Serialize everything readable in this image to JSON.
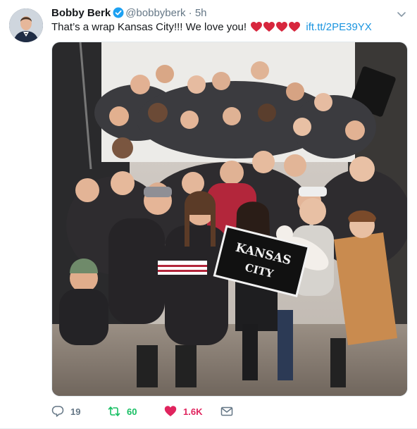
{
  "tweet": {
    "author": {
      "name": "Bobby Berk",
      "handle": "@bobbyberk",
      "separator": "·",
      "time": "5h",
      "verified": true
    },
    "text_main": "That’s a wrap Kansas City!!! We love you!",
    "hearts_count": 4,
    "link": "ift.tt/2PE39YX",
    "image": {
      "banner_line1": "KANSAS",
      "banner_line2": "CITY"
    },
    "stats": {
      "replies": "19",
      "retweets": "60",
      "likes": "1.6K"
    },
    "colors": {
      "link": "#1b95e0",
      "retweet": "#17bf63",
      "like": "#e0245e",
      "muted": "#657786",
      "verified": "#1da1f2"
    },
    "icons": [
      "caret-down-icon",
      "verified-badge-icon",
      "heart-emoji-icon",
      "reply-icon",
      "retweet-icon",
      "like-icon",
      "direct-message-icon"
    ]
  }
}
